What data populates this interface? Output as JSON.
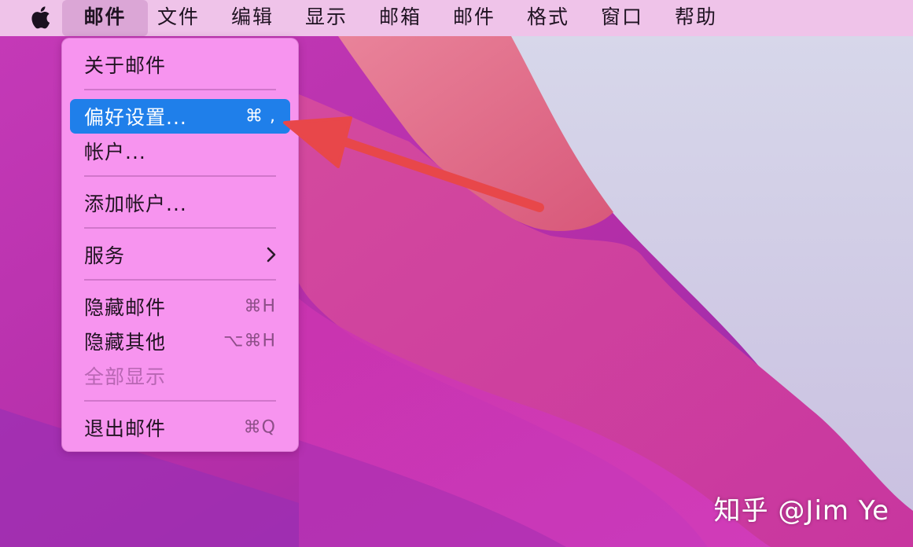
{
  "menubar": {
    "apple_icon": "apple-logo-icon",
    "items": [
      {
        "label": "邮件",
        "active": true
      },
      {
        "label": "文件"
      },
      {
        "label": "编辑"
      },
      {
        "label": "显示"
      },
      {
        "label": "邮箱"
      },
      {
        "label": "邮件"
      },
      {
        "label": "格式"
      },
      {
        "label": "窗口"
      },
      {
        "label": "帮助"
      }
    ]
  },
  "menu": {
    "items": [
      {
        "label": "关于邮件",
        "shortcut": ""
      },
      {
        "label": "偏好设置...",
        "shortcut": "⌘ ,",
        "highlighted": true
      },
      {
        "label": "帐户...",
        "shortcut": ""
      },
      {
        "label": "添加帐户...",
        "shortcut": ""
      },
      {
        "label": "服务",
        "submenu": true
      },
      {
        "label": "隐藏邮件",
        "shortcut": "⌘H"
      },
      {
        "label": "隐藏其他",
        "shortcut": "⌥⌘H"
      },
      {
        "label": "全部显示",
        "disabled": true
      },
      {
        "label": "退出邮件",
        "shortcut": "⌘Q"
      }
    ]
  },
  "annotation": {
    "color": "#e8474a",
    "icon": "red-arrow-icon"
  },
  "watermark": {
    "text": "知乎 @Jim Ye"
  },
  "colors": {
    "highlight": "#1f7fea",
    "menu_bg": "#f794ef",
    "menubar_bg": "#efc3e9"
  }
}
